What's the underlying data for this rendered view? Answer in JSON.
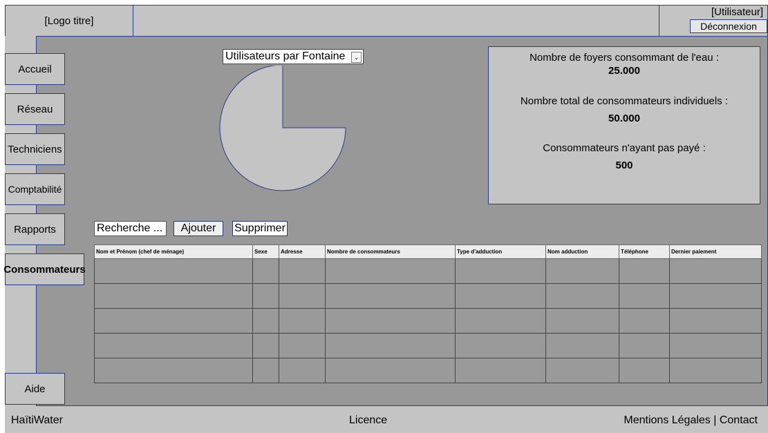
{
  "header": {
    "logo": "[Logo titre]",
    "user": "[Utilisateur]",
    "logout_label": "Déconnexion"
  },
  "sidebar": {
    "items": [
      {
        "label": "Accueil",
        "active": false
      },
      {
        "label": "Réseau",
        "active": false
      },
      {
        "label": "Techniciens",
        "active": false
      },
      {
        "label": "Comptabilité",
        "active": false
      },
      {
        "label": "Rapports",
        "active": false
      },
      {
        "label": "Consommateurs",
        "active": true
      }
    ],
    "help": "Aide"
  },
  "chart_select": {
    "selected": "Utilisateurs par Fontaine",
    "arrow_icon": "chevron-down-icon"
  },
  "chart_data": {
    "type": "pie",
    "values": [
      75,
      25
    ],
    "shown": [
      true,
      false
    ],
    "colors": {
      "fill": "#c4c4c4",
      "stroke": "#2a3a8a"
    }
  },
  "stats": {
    "households_label": "Nombre de foyers consommant de l'eau :",
    "households_value": "25.000",
    "individuals_label": "Nombre total de consommateurs individuels :",
    "individuals_value": "50.000",
    "unpaid_label": "Consommateurs n'ayant pas payé :",
    "unpaid_value": "500"
  },
  "toolbar": {
    "search_placeholder": "Recherche ...",
    "add_label": "Ajouter",
    "delete_label": "Supprimer"
  },
  "table": {
    "columns": [
      "Nom et Prénom (chef de ménage)",
      "Sexe",
      "Adresse",
      "Nombre de consommateurs",
      "Type d'adduction",
      "Nom adduction",
      "Téléphone",
      "Dernier paiement"
    ],
    "rows": [
      [
        "",
        "",
        "",
        "",
        "",
        "",
        "",
        ""
      ],
      [
        "",
        "",
        "",
        "",
        "",
        "",
        "",
        ""
      ],
      [
        "",
        "",
        "",
        "",
        "",
        "",
        "",
        ""
      ],
      [
        "",
        "",
        "",
        "",
        "",
        "",
        "",
        ""
      ],
      [
        "",
        "",
        "",
        "",
        "",
        "",
        "",
        ""
      ]
    ]
  },
  "footer": {
    "brand": "HaïtiWater",
    "licence": "Licence",
    "legal": "Mentions Légales | Contact"
  },
  "colors": {
    "panel": "#c4c4c4",
    "background": "#989898",
    "border": "#2a3a8a"
  }
}
